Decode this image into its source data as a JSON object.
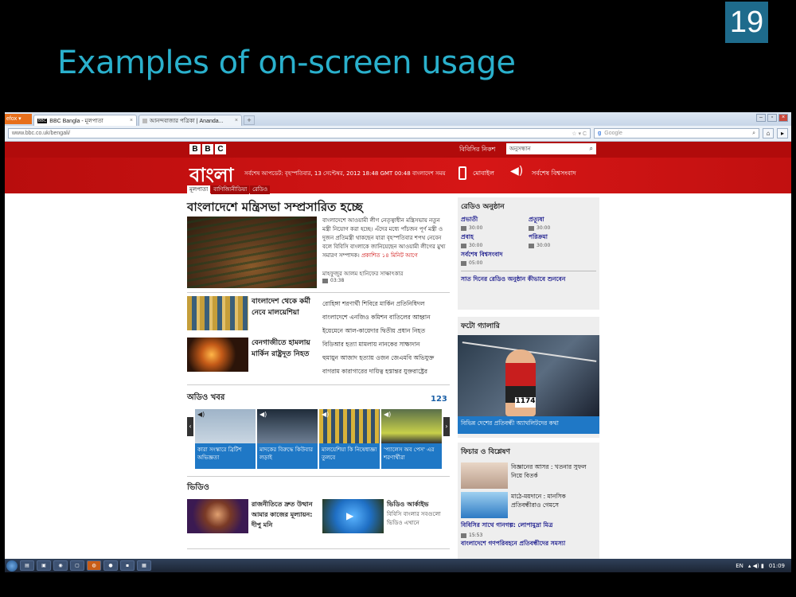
{
  "slide": {
    "number": "19",
    "title": "Examples of on-screen usage"
  },
  "browser": {
    "firefox_button": "efox ▾",
    "tabs": [
      {
        "label": "BBC Bangla - মূলপাতা",
        "active": true
      },
      {
        "label": "আনন্দবাজার পত্রিকা | Ananda...",
        "active": false
      }
    ],
    "new_tab": "+",
    "url": "www.bbc.co.uk/bengali/",
    "search_engine": "Google",
    "search_placeholder": "Google"
  },
  "bbc": {
    "logo": [
      "B",
      "B",
      "C"
    ],
    "search_label": "বিবিসির নিকশ",
    "search_value": "অনুসন্ধান",
    "site_title": "বাংলা",
    "dateline": "সর্বশেষ আপডেট: বৃহস্পতিবার, 13 সেপ্টেম্বর, 2012 18:48 GMT 00:48 বাংলাদেশ সময়",
    "mobile_label": "মোবাইল",
    "listen_label": "সর্বশেষ বিশ্বসংবাদ",
    "nav": [
      "মূলপাতা",
      "বাণিজ্যিনীডিয়া",
      "রেডিও"
    ]
  },
  "main": {
    "headline": "বাংলাদেশে মন্ত্রিসভা সম্প্রসারিত হচ্ছে",
    "summary": "বাংলাদেশে আওয়ামী লীগ নেতৃত্বাধীন মন্ত্রিসভায় নতুন মন্ত্রী নিয়োগ করা হচ্ছে। এঁদের মধ্যে পাঁচজন পূর্ণ মন্ত্রী ও দুজন প্রতিমন্ত্রী থাকছেন যারা বৃহস্পতিবার শপথ নেবেন বলে বিবিসি বাংলাকে জানিয়েছেন আওয়ামী লীগের মুখ্য সমারণ সম্পাদক।",
    "summary_time": "প্রকাশিত ১৪ মিনিট আগে",
    "byline": "মাহফুজুর আলম হানিফের সাক্ষাৎকার",
    "byline_duration": "03:38",
    "story1": "বাংলাদেশ থেকে কর্মী নেবে মালয়েশিয়া",
    "story2": "বেনগাজীতে হামলায় মার্কিন রাষ্ট্রদূত নিহত",
    "links": [
      "রোহিঙ্গা শরণার্থী শিবিরে মার্কিন প্রতিনিধিদল",
      "বাংলাদেশে এনজিও কমিশন বাতিলের আহ্বান",
      "ইয়েমেনে আল-কায়েদার দ্বিতীয় প্রধান নিহত",
      "বিডিআর হত্যা মামলায় নানকের সাক্ষ্যদান",
      "হুমায়ুন আজাদ হত্যায় ওজন জেএমবি অভিযুক্ত",
      "বাগরাম কারাগারের দায়িত্ব হস্তান্তর যুক্তরাষ্ট্রের"
    ]
  },
  "audio": {
    "title": "অডিও খবর",
    "pager": "123",
    "items": [
      "কারা সংস্কারে ব্রিটিশ অভিজ্ঞতা",
      "মাদকের বিরুদ্ধে কিউবার লড়াই",
      "মালয়েশিয়া কি নিষেধাজ্ঞা তুলবে",
      "'প্যালেস অব পেস' এর শরণার্থীরা"
    ]
  },
  "video": {
    "title": "ভিডিও",
    "item1": "রাজনীতিতে দ্রুত উত্থান আমার কাজের মূল্যায়ন: দীপু মনি",
    "item2_title": "ভিডিও আর্কাইভ",
    "item2_desc": "বিবিসি বাংলার সবগুলো ভিডিও এখানে"
  },
  "radio": {
    "title": "রেডিও অনুষ্ঠান",
    "programs": [
      {
        "name": "প্রভাতী",
        "time": "30:00"
      },
      {
        "name": "প্রত্যূষা",
        "time": "30:00"
      },
      {
        "name": "প্রবাহ",
        "time": "30:00"
      },
      {
        "name": "পরিক্রমা",
        "time": "30:00"
      }
    ],
    "latest": "সর্বশেষ বিশ্বসংবাদ",
    "latest_time": "05:00",
    "how_to": "সাত দিনের রেডিও অনুষ্ঠান কীভাবে শুনবেন"
  },
  "gallery": {
    "title": "ফটো গ্যালারি",
    "bib": "1174",
    "caption": "বিভিন্ন দেশের প্রতিবন্ধী অ্যাথলিটদের কথা"
  },
  "features": {
    "title": "ফিচার ও বিশ্লেষণ",
    "items": [
      "বিজ্ঞানের আসর : খতনার সুফল নিয়ে বিতর্ক",
      "মাঠে-ময়দানে : মানসিক প্রতিবন্ধীরাও গেমসে"
    ],
    "extra": "বিবিসির সাথে গানগল্প: লোপামুদ্রা মিত্র",
    "extra_time": "15:53",
    "last": "বাংলাদেশে গণপরিবহনে প্রতিবন্ধীদের সমস্যা"
  },
  "taskbar": {
    "lang": "EN",
    "clock": "01:09"
  }
}
